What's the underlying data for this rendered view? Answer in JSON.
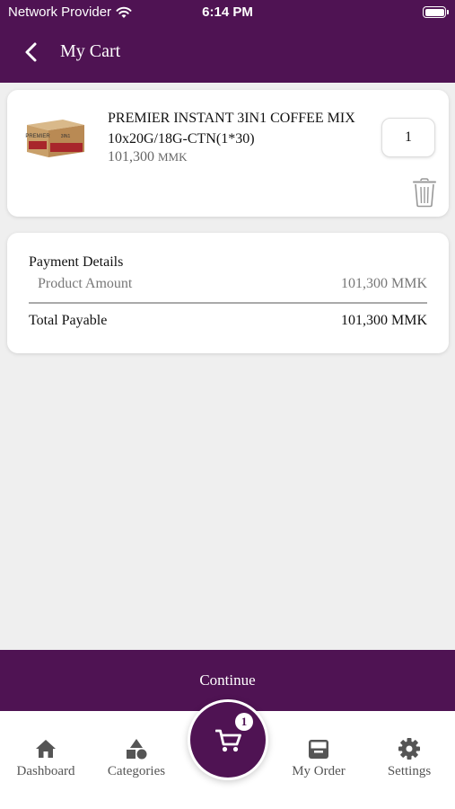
{
  "status_bar": {
    "carrier": "Network Provider",
    "time": "6:14 PM"
  },
  "header": {
    "title": "My Cart"
  },
  "cart_item": {
    "name": "PREMIER INSTANT 3IN1 COFFEE MIX 10x20G/18G-CTN(1*30)",
    "price": "101,300",
    "currency": "MMK",
    "quantity": "1",
    "image_box_label": "PREMIER"
  },
  "payment": {
    "title": "Payment Details",
    "product_amount_label": "Product Amount",
    "product_amount_value": "101,300 MMK",
    "total_label": "Total Payable",
    "total_value": "101,300 MMK"
  },
  "continue_label": "Continue",
  "tabs": {
    "dashboard": "Dashboard",
    "categories": "Categories",
    "my_order": "My Order",
    "settings": "Settings"
  },
  "cart_badge": "1",
  "colors": {
    "brand": "#4f1353",
    "background": "#efefef"
  }
}
